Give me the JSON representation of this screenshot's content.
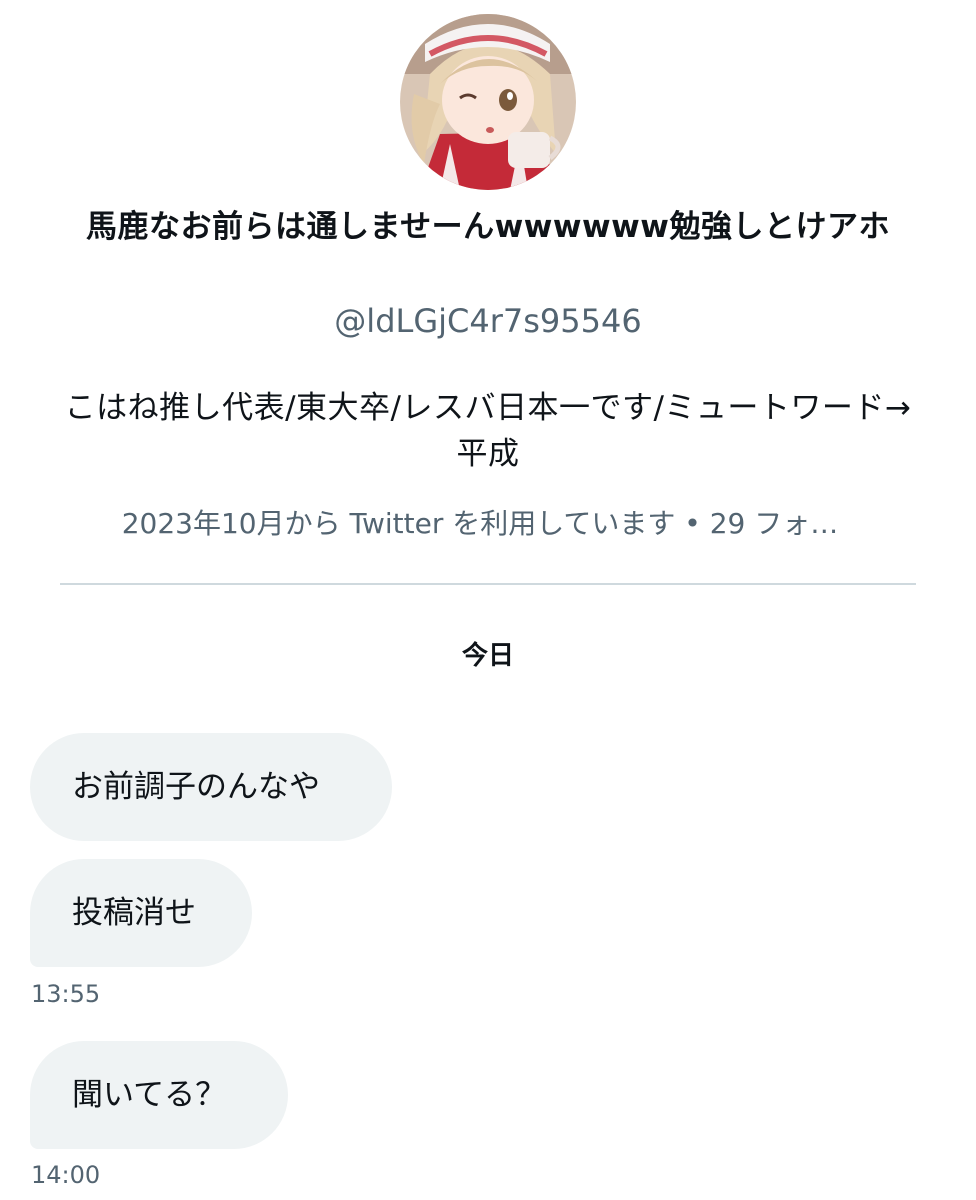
{
  "profile": {
    "avatar_icon": "anime-girl-avatar-icon",
    "display_name": "馬鹿なお前らは通しませーんwwwwww勉強しとけアホ",
    "handle": "@ldLGjC4r7s95546",
    "bio": "こはね推し代表/東大卒/レスバ日本一です/ミュートワード→平成",
    "meta": "2023年10月から Twitter を利用しています • 29 フォ…"
  },
  "conversation": {
    "day_label": "今日",
    "messages": [
      {
        "text": "お前調子のんなや"
      },
      {
        "text": "投稿消せ"
      },
      {
        "text": "聞いてる？"
      }
    ],
    "timestamps": [
      "13:55",
      "14:00"
    ]
  },
  "colors": {
    "bubble_bg": "#eff3f4",
    "secondary_text": "#536471",
    "divider": "#cfd9de"
  }
}
